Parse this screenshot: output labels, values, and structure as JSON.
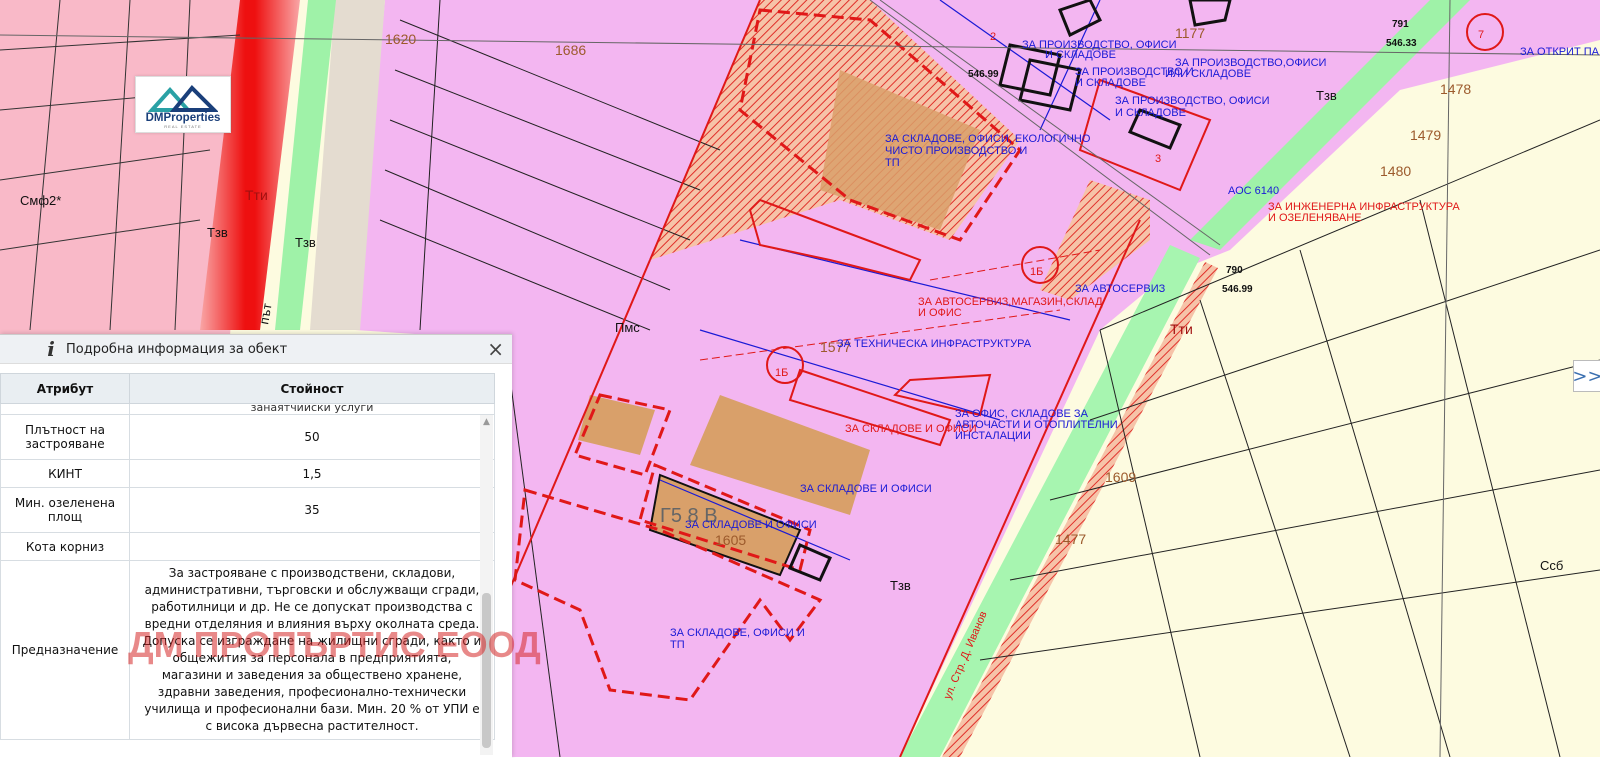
{
  "map": {
    "parcels": [
      "1620",
      "1686",
      "1577",
      "1605",
      "1609",
      "1477",
      "1478",
      "1479",
      "1480",
      "1177"
    ],
    "zones": [
      "Смф2*",
      "Тзв",
      "Тзв",
      "Пмс",
      "Тзв",
      "Ссб",
      "Тзв",
      "Г5 8 В"
    ],
    "texts": {
      "z1": "ЗА СКЛАДОВЕ, ОФИСИ, ЕКОЛОГИЧНО",
      "z1b": "ЧИСТО ПРОИЗВОДСТВО И",
      "z1c": "ТП",
      "z2": "ЗА ПРОИЗВОДСТВО, ОФИСИ",
      "z2b": "И СКЛАДОВЕ",
      "z3": "ЗА ПРОИЗВОДСТВО И",
      "z3b": "И СКЛАДОВЕ",
      "z4": "ЗА ПРОИЗВОДСТВО,ОФИСИ",
      "z4b": "ИЛИ СКЛАДОВЕ",
      "z5": "ЗА ПРОИЗВОДСТВО, ОФИСИ",
      "z5b": "И СКЛАДОВЕ",
      "aoc": "АОС 6140",
      "ing1": "ЗА ИНЖЕНЕРНА ИНФРАСТРУКТУРА",
      "ing2": "И ОЗЕЛЕНЯВАНЕ",
      "avto": "ЗА АВТОСЕРВИЗ",
      "avto2": "ЗА АВТОСЕРВИЗ,МАГАЗИН,СКЛАД",
      "avto2b": "И ОФИС",
      "tech": "ЗА ТЕХНИЧЕСКА ИНФРАСТРУКТУРА",
      "sklo": "ЗА СКЛАДОВЕ И ОФИСИ",
      "ofis1": "ЗА ОФИС, СКЛАДОВЕ ЗА",
      "ofis2": "АВТОЧАСТИ И ОТОПЛИТЕЛНИ",
      "ofis3": "ИНСТАЛАЦИИ",
      "sklo2": "ЗА СКЛАДОВЕ И ОФИСИ",
      "sklo3": "ЗА СКЛАДОВЕ И ОФИСИ",
      "sklotp": "ЗА СКЛАДОВЕ, ОФИСИ И",
      "sklotp2": "ТП",
      "open": "ЗА ОТКРИТ ПА",
      "lbl1b": "1Б",
      "lbl1b2": "1Б",
      "lbl7": "7",
      "lbl2": "2",
      "lbl3": "3",
      "elev1": "546.99",
      "elev2": "546.99",
      "elev3": "546.33",
      "n791": "791",
      "n790": "790",
      "ulica": "ул. Стр. Д. Иванов",
      "pat": "път",
      "tti": "Тти",
      "tti2": "Тти"
    }
  },
  "logo": {
    "title": "DMProperties",
    "subtitle": "REAL ESTATE"
  },
  "expand_label": ">>",
  "panel": {
    "title": "Подробна информация за обект",
    "close": "×",
    "headers": {
      "attr": "Атрибут",
      "value": "Стойност"
    },
    "clipped_row": "занаятчийски услуги",
    "rows": [
      {
        "attr": "Плътност на застрояване",
        "value": "50"
      },
      {
        "attr": "КИНТ",
        "value": "1,5"
      },
      {
        "attr": "Мин. озеленена площ",
        "value": "35"
      },
      {
        "attr": "Кота корниз",
        "value": ""
      },
      {
        "attr": "Предназначение",
        "value": "За застрояване с производствени, складови, административни, търговски и обслужващи сгради, работилници и др. Не се допускат производства с вредни отделяния и влияния върху околната среда. Допуска се изграждане на жилищни сгради, както и общежития за персонала в предприятията, магазини и заведения за обществено хранене, здравни заведения, професионално-технически училища и професионални бази. Мин. 20 % от УПИ е с висока дървесна растителност."
      }
    ],
    "watermark": "ДМ ПРОПЪРТИС ЕООД"
  }
}
